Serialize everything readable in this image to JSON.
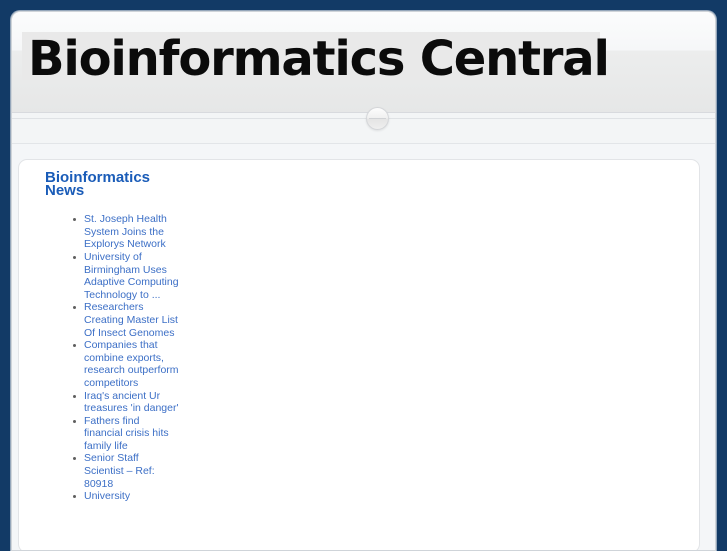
{
  "colors": {
    "desktop_background": "#123a66",
    "page_background": "#f4f6f8",
    "card_background": "#ffffff",
    "heading_blue": "#1a5cb8",
    "link_blue": "#3c6fc6",
    "title_black": "#0b0b0b",
    "masthead_highlight": "#e9e9e9"
  },
  "masthead": {
    "title": "Bioinformatics Central"
  },
  "splitter": {
    "handle_icon": "circle-collapse-handle-icon"
  },
  "news_widget": {
    "heading": "Bioinformatics News",
    "items": [
      {
        "label": "St. Joseph Health System Joins the Explorys Network"
      },
      {
        "label": "University of Birmingham Uses Adaptive Computing Technology to ..."
      },
      {
        "label": "Researchers Creating Master List Of Insect Genomes"
      },
      {
        "label": "Companies that combine exports, research outperform competitors"
      },
      {
        "label": "Iraq's ancient Ur treasures 'in danger'"
      },
      {
        "label": "Fathers find financial crisis hits family life"
      },
      {
        "label": "Senior Staff Scientist – Ref: 80918"
      },
      {
        "label": "University"
      }
    ]
  }
}
